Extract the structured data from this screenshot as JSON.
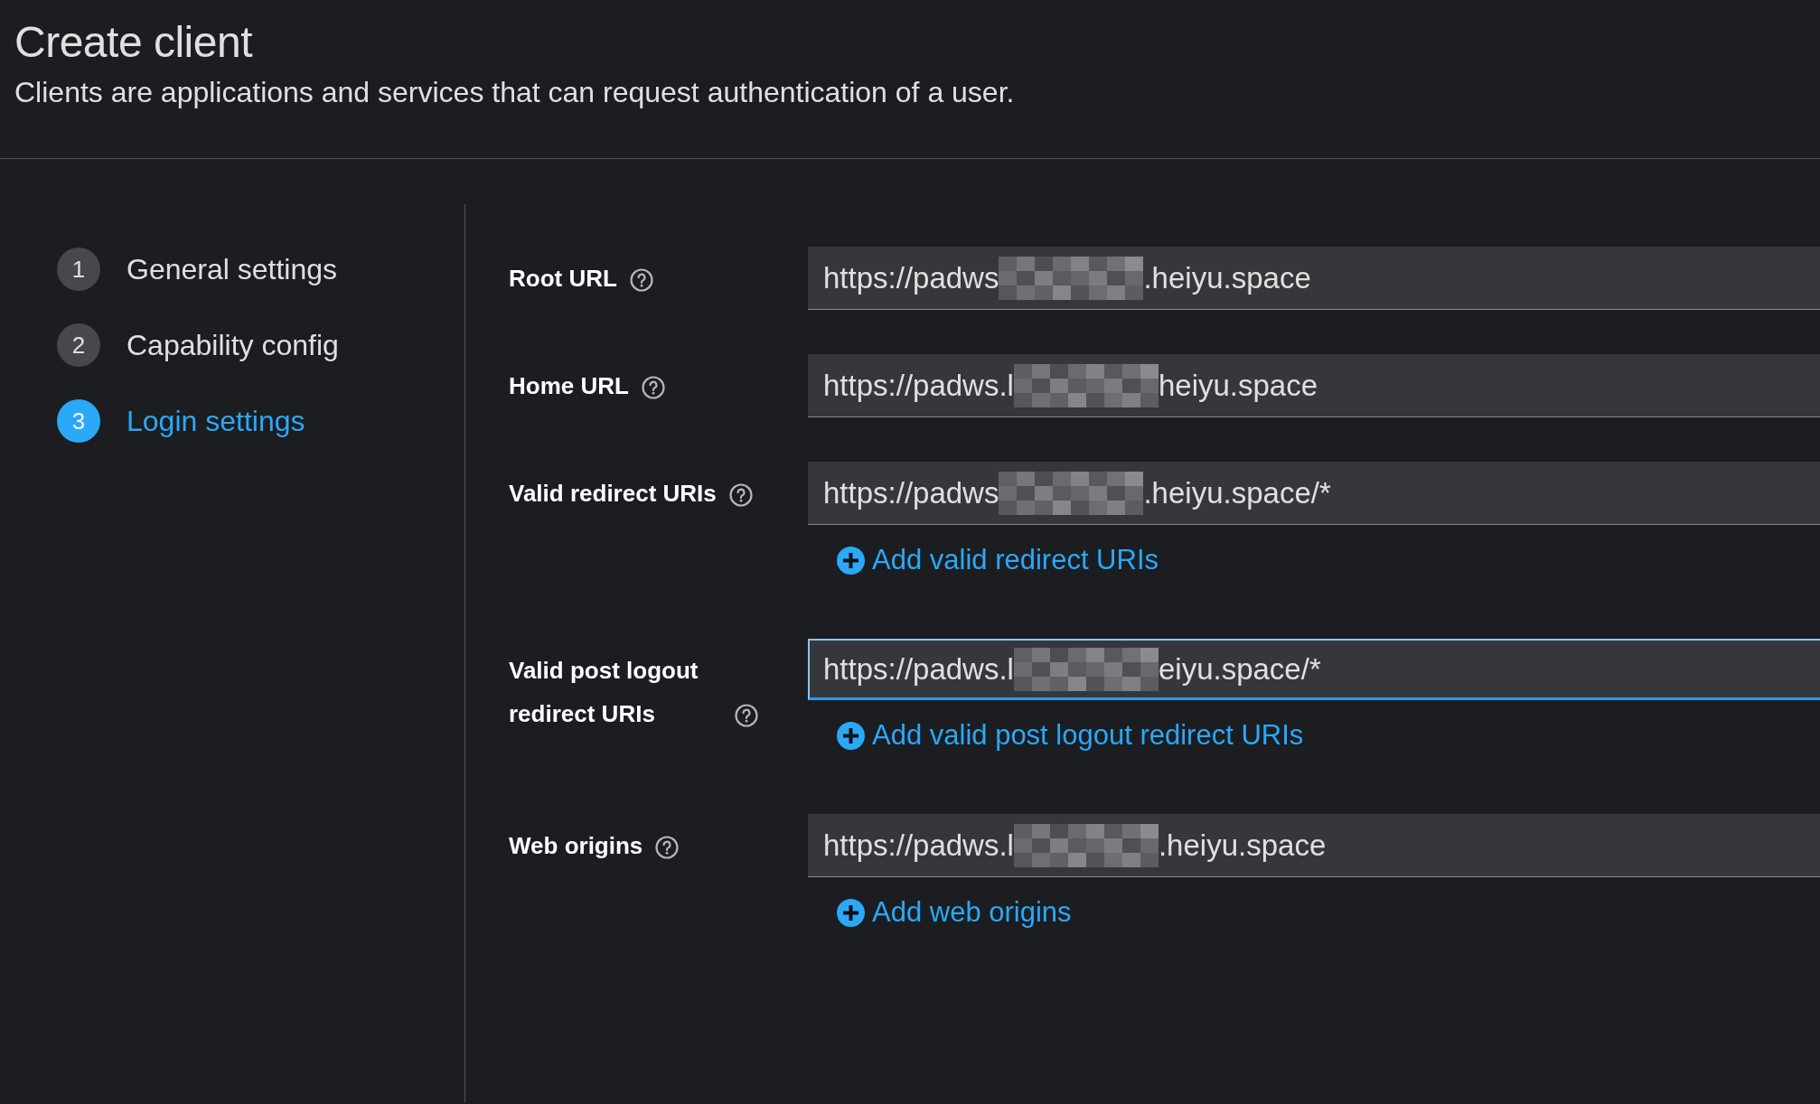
{
  "page": {
    "title": "Create client",
    "description": "Clients are applications and services that can request authentication of a user."
  },
  "steps": [
    {
      "number": "1",
      "label": "General settings",
      "selected": false
    },
    {
      "number": "2",
      "label": "Capability config",
      "selected": false
    },
    {
      "number": "3",
      "label": "Login settings",
      "selected": true
    }
  ],
  "fields": [
    {
      "label": "Root URL",
      "value_start": "https://padws",
      "value_end": ".heiyu.space",
      "redacted": true,
      "focused": false
    },
    {
      "label": "Home URL",
      "value_start": "https://padws.l",
      "value_end": "heiyu.space",
      "redacted": true,
      "focused": false
    },
    {
      "label": "Valid redirect URIs",
      "value_start": "https://padws",
      "value_end": ".heiyu.space/*",
      "redacted": true,
      "focused": false,
      "add_link": "Add valid redirect URIs"
    },
    {
      "label": "Valid post logout redirect URIs",
      "value_start": "https://padws.l",
      "value_end": "eiyu.space/*",
      "redacted": true,
      "focused": true,
      "add_link": "Add valid post logout redirect URIs"
    },
    {
      "label": "Web origins",
      "value_start": "https://padws.l",
      "value_end": ".heiyu.space",
      "redacted": true,
      "focused": false,
      "add_link": "Add web origins"
    }
  ]
}
